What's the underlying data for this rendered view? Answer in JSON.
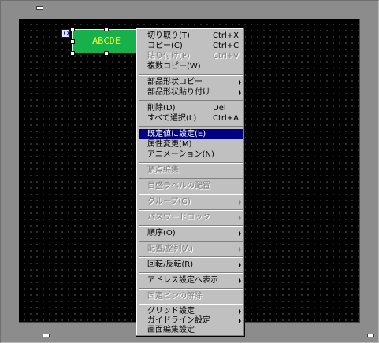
{
  "canvas": {
    "part": {
      "text": "ABCDE",
      "fill_color": "#17b04a",
      "text_color": "#f4ff30",
      "icon": "search-tool-icon"
    }
  },
  "context_menu": {
    "items": [
      {
        "label": "切り取り(T)",
        "shortcut": "Ctrl+X",
        "enabled": true
      },
      {
        "label": "コピー(C)",
        "shortcut": "Ctrl+C",
        "enabled": true
      },
      {
        "label": "貼り付け(P)",
        "shortcut": "Ctrl+V",
        "enabled": false
      },
      {
        "label": "複数コピー(W)",
        "shortcut": "",
        "enabled": true
      },
      {
        "label": "部品形状コピー",
        "shortcut": "",
        "enabled": true,
        "submenu": true
      },
      {
        "label": "部品形状貼り付け",
        "shortcut": "",
        "enabled": true,
        "submenu": true
      },
      {
        "label": "削除(D)",
        "shortcut": "Del",
        "enabled": true
      },
      {
        "label": "すべて選択(L)",
        "shortcut": "Ctrl+A",
        "enabled": true
      },
      {
        "label": "既定値に設定(E)",
        "shortcut": "",
        "enabled": true,
        "highlighted": true
      },
      {
        "label": "属性変更(M)",
        "shortcut": "",
        "enabled": true
      },
      {
        "label": "アニメーション(N)",
        "shortcut": "",
        "enabled": true
      },
      {
        "label": "頂点編集",
        "shortcut": "",
        "enabled": false
      },
      {
        "label": "目盛ラベルの配置",
        "shortcut": "",
        "enabled": false
      },
      {
        "label": "グループ(G)",
        "shortcut": "",
        "enabled": false,
        "submenu": true
      },
      {
        "label": "パスワードロック",
        "shortcut": "",
        "enabled": false,
        "submenu": true
      },
      {
        "label": "順序(O)",
        "shortcut": "",
        "enabled": true,
        "submenu": true
      },
      {
        "label": "配置/整列(A)",
        "shortcut": "",
        "enabled": false,
        "submenu": true
      },
      {
        "label": "回転/反転(R)",
        "shortcut": "",
        "enabled": true,
        "submenu": true
      },
      {
        "label": "アドレス設定へ表示",
        "shortcut": "",
        "enabled": true,
        "submenu": true
      },
      {
        "label": "固定ピンの解除",
        "shortcut": "",
        "enabled": false
      },
      {
        "label": "グリッド設定",
        "shortcut": "",
        "enabled": true,
        "submenu": true
      },
      {
        "label": "ガイドライン設定",
        "shortcut": "",
        "enabled": true,
        "submenu": true
      },
      {
        "label": "画面編集設定",
        "shortcut": "",
        "enabled": true
      }
    ],
    "highlight_color": "#000080"
  }
}
